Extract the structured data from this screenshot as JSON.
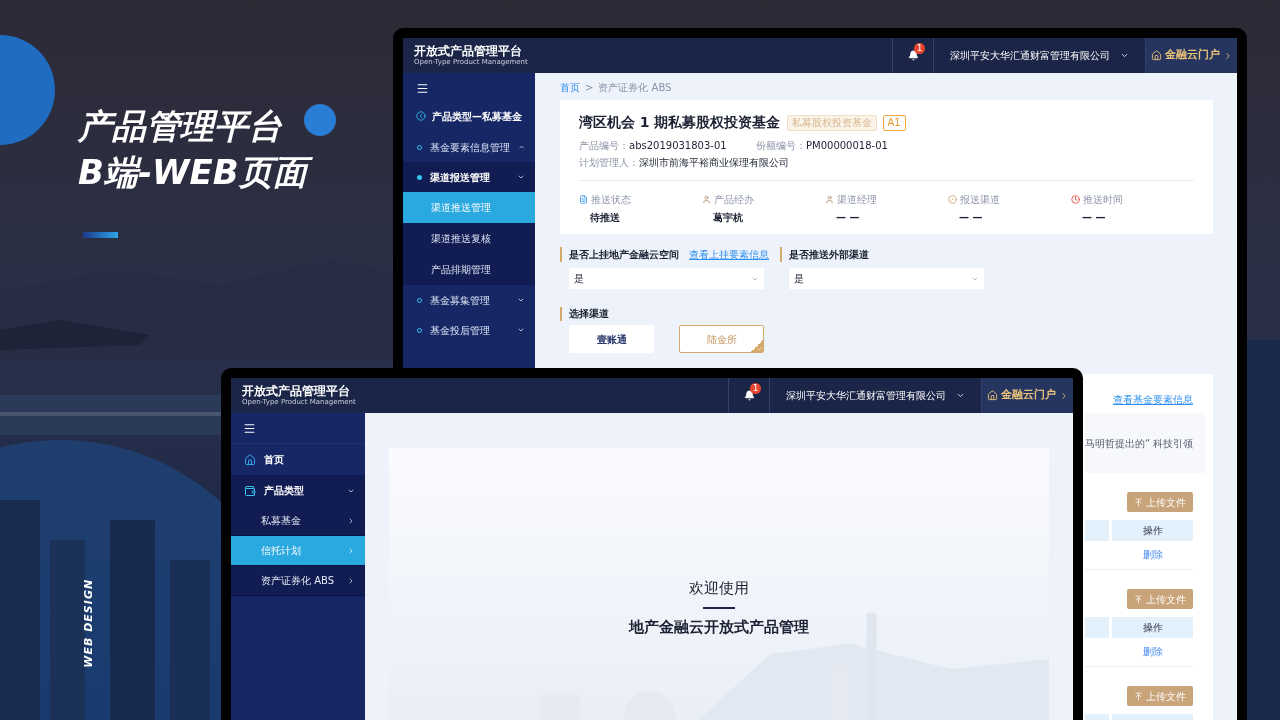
{
  "showcase": {
    "title": "产品管理平台",
    "subtitle": "B端-WEB页面",
    "side_label": "WEB DESIGN"
  },
  "back_window": {
    "brand": {
      "name": "开放式产品管理平台",
      "tagline": "Open-Type Product Management"
    },
    "notification_count": "1",
    "company": "深圳平安大华汇通财富管理有限公司",
    "portal": "金融云门户",
    "sidebar": {
      "back": "产品类型—私募基金",
      "items": [
        {
          "label": "基金要素信息管理",
          "active": false,
          "expanded": true
        },
        {
          "label": "渠道报送管理",
          "active": true,
          "expanded": false,
          "children": [
            {
              "label": "渠道推送管理",
              "selected": true
            },
            {
              "label": "渠道推送复核",
              "selected": false
            },
            {
              "label": "产品排期管理",
              "selected": false
            }
          ]
        },
        {
          "label": "基金募集管理",
          "active": false,
          "expanded": false
        },
        {
          "label": "基金投后管理",
          "active": false,
          "expanded": false
        }
      ]
    },
    "breadcrumb": {
      "items": [
        "首页",
        "资产证券化 ABS"
      ],
      "separator": ">"
    },
    "product": {
      "title": "湾区机会 1 期私募股权投资基金",
      "tags": [
        {
          "text": "私募股权投资基金",
          "kind": "category"
        },
        {
          "text": "A1",
          "kind": "grade"
        }
      ],
      "fields": [
        {
          "label": "产品编号：",
          "value": "abs2019031803-01"
        },
        {
          "label": "份额编号：",
          "value": "PM00000018-01"
        },
        {
          "label": "计划管理人：",
          "value": "深圳市前海平裕商业保理有限公司"
        }
      ],
      "stats": [
        {
          "kind": "status",
          "label": "推送状态",
          "value": "待推送"
        },
        {
          "kind": "handler",
          "label": "产品经办",
          "value": "葛宇杭"
        },
        {
          "kind": "manager",
          "label": "渠道经理",
          "value": "— —"
        },
        {
          "kind": "channel",
          "label": "报送渠道",
          "value": "— —"
        },
        {
          "kind": "time",
          "label": "推送时间",
          "value": "— —"
        }
      ]
    },
    "questions": [
      {
        "label": "是否上挂地产金融云空间",
        "link": "查看上挂要素信息",
        "value": "是"
      },
      {
        "label": "是否推送外部渠道",
        "value": "是"
      }
    ],
    "channels": {
      "label": "选择渠道",
      "options": [
        {
          "label": "壹账通",
          "selected": false
        },
        {
          "label": "陆金所",
          "selected": true
        }
      ]
    },
    "files": {
      "link": "查看基金要素信息",
      "excerpt": "马明哲提出的“ 科技引领",
      "sections": [
        {
          "button": "上传文件",
          "column": "操作",
          "action": "删除"
        },
        {
          "button": "上传文件",
          "column": "操作",
          "action": "删除"
        },
        {
          "button": "上传文件"
        }
      ]
    }
  },
  "front_window": {
    "brand": {
      "name": "开放式产品管理平台",
      "tagline": "Open-Type Product Management"
    },
    "notification_count": "1",
    "company": "深圳平安大华汇通财富管理有限公司",
    "portal": "金融云门户",
    "sidebar": {
      "items": [
        {
          "kind": "home",
          "label": "首页"
        },
        {
          "kind": "category",
          "label": "产品类型",
          "children": [
            {
              "label": "私募基金",
              "selected": false
            },
            {
              "label": "信托计划",
              "selected": true
            },
            {
              "label": "资产证券化 ABS",
              "selected": false
            }
          ]
        }
      ]
    },
    "welcome": {
      "title": "欢迎使用",
      "subtitle": "地产金融云开放式产品管理"
    }
  }
}
